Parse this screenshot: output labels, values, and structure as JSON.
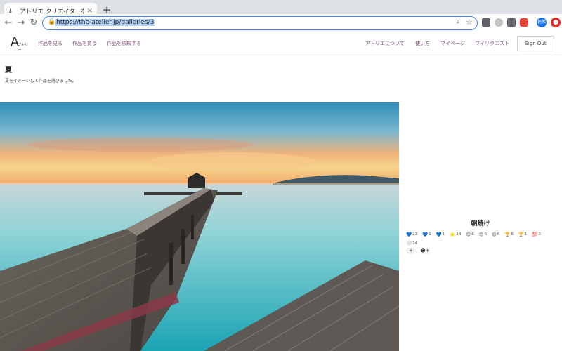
{
  "browser": {
    "tab_title": "アトリエ クリエイターを応援す",
    "tab_close": "×",
    "new_tab": "+",
    "url": "https://the-atelier.jp/galleries/3",
    "profile_initials": "佐茉"
  },
  "header": {
    "logo_text": "アトリエ",
    "nav_left": [
      "作品を見る",
      "作品を買う",
      "作品を依頼する"
    ],
    "nav_right": [
      "アトリエについて",
      "使い方",
      "マイページ",
      "マイリクエスト"
    ],
    "sign_out": "Sign Out",
    "accent_color": "#7a4b76"
  },
  "gallery": {
    "title": "夏",
    "description": "夏をイメージして作品を選びました。"
  },
  "work": {
    "title": "朝焼け",
    "reactions": [
      {
        "emoji": "💙",
        "count": "23"
      },
      {
        "emoji": "💙",
        "count": "1"
      },
      {
        "emoji": "💙",
        "count": "1"
      },
      {
        "emoji": "⭐",
        "count": "14"
      },
      {
        "emoji": "😊",
        "count": "6"
      },
      {
        "emoji": "😍",
        "count": "6"
      },
      {
        "emoji": "😆",
        "count": "6"
      },
      {
        "emoji": "🏆",
        "count": "6"
      },
      {
        "emoji": "🏆",
        "count": "1"
      },
      {
        "emoji": "💯",
        "count": "3"
      },
      {
        "emoji": "🤍",
        "count": "14"
      }
    ],
    "add_label": "+",
    "more_label": "☻+"
  }
}
